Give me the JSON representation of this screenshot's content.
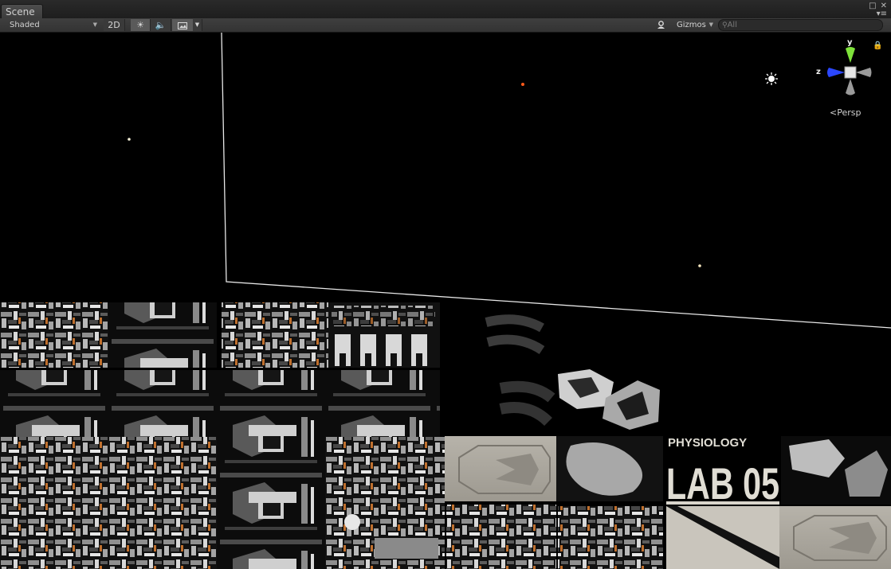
{
  "tab": {
    "label": "Scene"
  },
  "toolbar": {
    "draw_mode": "Shaded",
    "mode_2d": "2D",
    "gizmos": "Gizmos",
    "search_placeholder": "All"
  },
  "gizmo": {
    "x_label": "",
    "y_label": "y",
    "z_label": "z",
    "projection": "Persp"
  },
  "texture": {
    "sign_line1": "PHYSIOLOGY",
    "sign_line2": "LAB 05"
  },
  "colors": {
    "y_axis": "#7ee23a",
    "z_axis": "#2b47ff",
    "bg": "#000000",
    "panel": "#383838"
  }
}
